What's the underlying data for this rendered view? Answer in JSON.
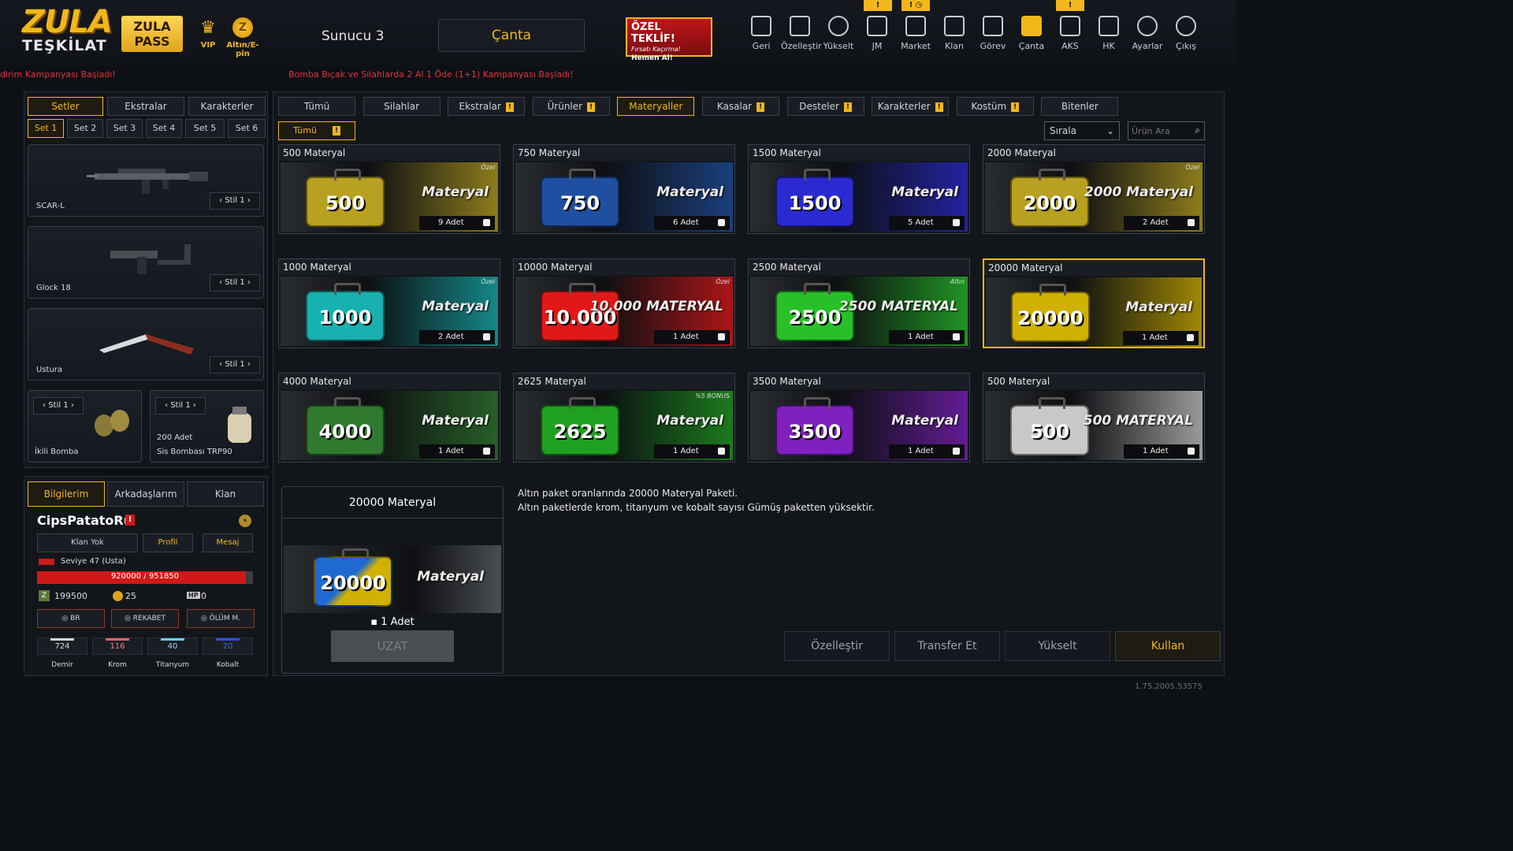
{
  "header": {
    "logo_line1": "ZULA",
    "logo_line2": "TEŞKİLAT",
    "pass_line1": "ZULA",
    "pass_line2": "PASS",
    "vip_label": "VIP",
    "gold_label": "Altın/E-pin",
    "server": "Sunucu 3",
    "bag_button": "Çanta",
    "offer_title": "ÖZEL TEKLİF!",
    "offer_sub": "Fırsatı Kaçırma!",
    "offer_cta": "Hemen Al!",
    "nav": [
      {
        "label": "Geri",
        "icon": "exit-icon"
      },
      {
        "label": "Özelleştir",
        "icon": "tools-icon"
      },
      {
        "label": "Yükselt",
        "icon": "upgrade-icon"
      },
      {
        "label": "JM",
        "icon": "jm-icon"
      },
      {
        "label": "Market",
        "icon": "cart-icon"
      },
      {
        "label": "Klan",
        "icon": "clan-icon"
      },
      {
        "label": "Görev",
        "icon": "task-icon"
      },
      {
        "label": "Çanta",
        "icon": "bag-icon"
      },
      {
        "label": "AKS",
        "icon": "aks-icon"
      },
      {
        "label": "HK",
        "icon": "wallet-icon"
      },
      {
        "label": "Ayarlar",
        "icon": "gear-icon"
      },
      {
        "label": "Çıkış",
        "icon": "power-icon"
      }
    ]
  },
  "ticker": {
    "left": "dirim Kampanyası Başladı!",
    "right": "Bomba Bıçak ve Silahlarda 2 Al 1 Öde (1+1) Kampanyası Başladı!"
  },
  "loadout": {
    "tabs": [
      "Setler",
      "Ekstralar",
      "Karakterler"
    ],
    "sets": [
      "Set 1",
      "Set 2",
      "Set 3",
      "Set 4",
      "Set 5",
      "Set 6"
    ],
    "weapons": [
      {
        "name": "SCAR-L",
        "style": "Stil 1"
      },
      {
        "name": "Glock 18",
        "style": "Stil 1"
      },
      {
        "name": "Ustura",
        "style": "Stil 1"
      }
    ],
    "grenades": [
      {
        "name": "İkili Bomba",
        "style": "Stil 1",
        "count": ""
      },
      {
        "name": "Sis Bombası TRP90",
        "style": "Stil 1",
        "count": "200 Adet"
      }
    ]
  },
  "profile": {
    "tabs": [
      "Bilgilerim",
      "Arkadaşlarım",
      "Klan"
    ],
    "username": "CipsPatatoRu",
    "buttons": [
      "Klan Yok",
      "Profil",
      "Mesaj"
    ],
    "level": "Seviye 47 (Usta)",
    "xp_current": "920000",
    "xp_total": "951850",
    "xp_fraction": 0.967,
    "currency_z": "199500",
    "currency_gold": "25",
    "currency_hp": "0",
    "modes": [
      "BR",
      "REKABET",
      "ÖLÜM M."
    ],
    "materials": [
      {
        "name": "Demir",
        "value": "724",
        "color": "#d8d8d8"
      },
      {
        "name": "Krom",
        "value": "116",
        "color": "#e06070"
      },
      {
        "name": "Titanyum",
        "value": "40",
        "color": "#6ad0f0"
      },
      {
        "name": "Kobalt",
        "value": "20",
        "color": "#3050e0"
      }
    ]
  },
  "inventory": {
    "tabs": [
      "Tümü",
      "Silahlar",
      "Ekstralar",
      "Ürünler",
      "Materyaller",
      "Kasalar",
      "Desteler",
      "Karakterler",
      "Kostüm",
      "Bitenler"
    ],
    "subfilter": "Tümü",
    "sort": "Sırala",
    "search_placeholder": "Ürün Ara",
    "items": [
      {
        "title": "500 Materyal",
        "case": "500",
        "text": "Materyal",
        "count": "9 Adet",
        "tag": "Özel",
        "color": "#b8a020"
      },
      {
        "title": "750 Materyal",
        "case": "750",
        "text": "Materyal",
        "count": "6 Adet",
        "tag": "",
        "color": "#1f4fa0"
      },
      {
        "title": "1500 Materyal",
        "case": "1500",
        "text": "Materyal",
        "count": "5 Adet",
        "tag": "",
        "color": "#2a2ad0"
      },
      {
        "title": "2000 Materyal",
        "case": "2000",
        "text": "2000 Materyal",
        "count": "2 Adet",
        "tag": "Özel",
        "color": "#b8a020"
      },
      {
        "title": "1000 Materyal",
        "case": "1000",
        "text": "Materyal",
        "count": "2 Adet",
        "tag": "Özel",
        "color": "#18b0b0"
      },
      {
        "title": "10000 Materyal",
        "case": "10.000",
        "text": "10.000 MATERYAL",
        "count": "1 Adet",
        "tag": "Özel",
        "color": "#e01818"
      },
      {
        "title": "2500 Materyal",
        "case": "2500",
        "text": "2500 MATERYAL",
        "count": "1 Adet",
        "tag": "Altın",
        "color": "#28c028"
      },
      {
        "title": "20000 Materyal",
        "case": "20000",
        "text": "Materyal",
        "count": "1 Adet",
        "tag": "",
        "color": "#d0b000"
      },
      {
        "title": "4000 Materyal",
        "case": "4000",
        "text": "Materyal",
        "count": "1 Adet",
        "tag": "",
        "color": "#2f7a2f"
      },
      {
        "title": "2625 Materyal",
        "case": "2625",
        "text": "Materyal",
        "count": "1 Adet",
        "tag": "%5 BONUS",
        "color": "#20a020"
      },
      {
        "title": "3500 Materyal",
        "case": "3500",
        "text": "Materyal",
        "count": "1 Adet",
        "tag": "",
        "color": "#8020c0"
      },
      {
        "title": "500 Materyal",
        "case": "500",
        "text": "500 MATERYAL",
        "count": "1 Adet",
        "tag": "",
        "color": "#c8c8c8"
      }
    ]
  },
  "detail": {
    "title": "20000 Materyal",
    "case": "20000",
    "text": "Materyal",
    "count": "1 Adet",
    "extend": "UZAT",
    "desc1": "Altın paket oranlarında 20000 Materyal Paketi.",
    "desc2": "Altın paketlerde krom, titanyum ve kobalt sayısı Gümüş paketten yüksektir.",
    "actions": [
      "Özelleştir",
      "Transfer Et",
      "Yükselt",
      "Kullan"
    ]
  },
  "version": "1.75.2005.53575",
  "accent": "#f2b71a"
}
